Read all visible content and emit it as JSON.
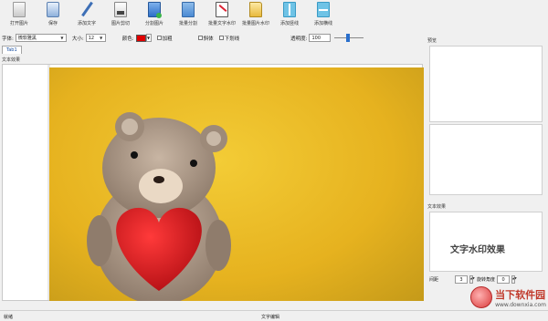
{
  "toolbar": {
    "buttons": [
      {
        "label": "打开图片",
        "icon": "open-file-icon"
      },
      {
        "label": "保存",
        "icon": "save-icon"
      },
      {
        "label": "添加文字",
        "icon": "add-text-icon"
      },
      {
        "label": "图片剪切",
        "icon": "crop-icon"
      },
      {
        "label": "分割图片",
        "icon": "split-image-icon"
      },
      {
        "label": "批量分割",
        "icon": "batch-split-icon"
      },
      {
        "label": "批量文字水印",
        "icon": "batch-text-watermark-icon"
      },
      {
        "label": "批量图片水印",
        "icon": "batch-image-watermark-icon"
      },
      {
        "label": "添加竖线",
        "icon": "vertical-line-icon"
      },
      {
        "label": "添加横线",
        "icon": "horizontal-line-icon"
      }
    ]
  },
  "format": {
    "font_label": "字体:",
    "font_value": "微软雅黑",
    "size_label": "大小:",
    "size_value": "12",
    "color_label": "颜色:",
    "color_value": "#e00000",
    "bold_label": "加粗",
    "italic_label": "斜体",
    "underline_label": "下划线",
    "opacity_label": "透明度:",
    "opacity_value": "100",
    "opacity_slider_level": 0.45
  },
  "tabs": [
    {
      "label": "Tab1"
    }
  ],
  "canvas": {
    "subtitle": "文本效果"
  },
  "right_panel": {
    "section1_label": "预览",
    "section2_label": "文本效果",
    "preview_text": "文字水印效果",
    "spacing_label": "间距",
    "spacing_value": "3",
    "rotate_label": "旋转角度",
    "rotate_value": "0"
  },
  "watermark": {
    "name": "当下软件园",
    "url": "www.downxia.com"
  },
  "statusbar": {
    "left": "就绪",
    "middle": "文字编辑"
  },
  "colors": {
    "background": "#f0f0f0",
    "accent": "#2a6fcc",
    "photo_bg": "#e6b21f"
  }
}
